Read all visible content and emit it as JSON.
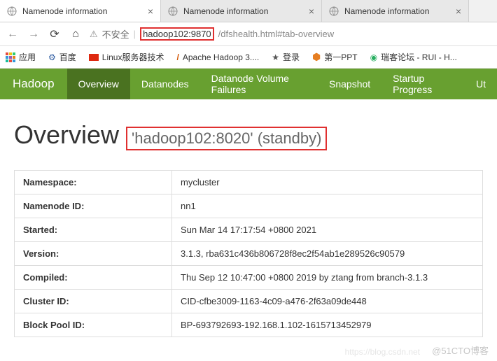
{
  "tabs": [
    {
      "title": "Namenode information"
    },
    {
      "title": "Namenode information"
    },
    {
      "title": "Namenode information"
    }
  ],
  "addr": {
    "insecure": "不安全",
    "host": "hadoop102:9870",
    "path": "/dfshealth.html#tab-overview"
  },
  "bookmarks": {
    "apps": "应用",
    "baidu": "百度",
    "linux": "Linux服务器技术",
    "hadoop": "Apache Hadoop 3....",
    "login": "登录",
    "ppt": "第一PPT",
    "rui": "瑞客论坛 - RUI - H..."
  },
  "nav": {
    "brand": "Hadoop",
    "items": [
      "Overview",
      "Datanodes",
      "Datanode Volume Failures",
      "Snapshot",
      "Startup Progress",
      "Ut"
    ]
  },
  "page": {
    "title": "Overview",
    "subtitle": "'hadoop102:8020' (standby)"
  },
  "table": [
    {
      "k": "Namespace:",
      "v": "mycluster"
    },
    {
      "k": "Namenode ID:",
      "v": "nn1"
    },
    {
      "k": "Started:",
      "v": "Sun Mar 14 17:17:54 +0800 2021"
    },
    {
      "k": "Version:",
      "v": "3.1.3, rba631c436b806728f8ec2f54ab1e289526c90579"
    },
    {
      "k": "Compiled:",
      "v": "Thu Sep 12 10:47:00 +0800 2019 by ztang from branch-3.1.3"
    },
    {
      "k": "Cluster ID:",
      "v": "CID-cfbe3009-1163-4c09-a476-2f63a09de448"
    },
    {
      "k": "Block Pool ID:",
      "v": "BP-693792693-192.168.1.102-1615713452979"
    }
  ],
  "watermark": "@51CTO博客",
  "watermark2": "https://blog.csdn.net"
}
